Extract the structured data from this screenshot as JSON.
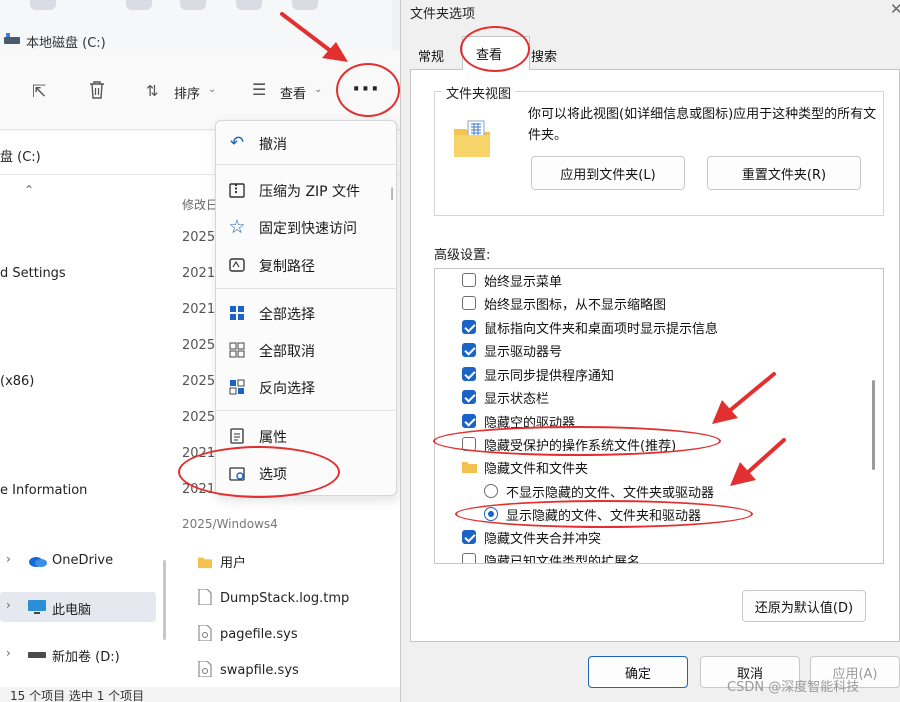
{
  "explorer": {
    "window_title": "本地磁盘 (C:)",
    "toolbar": {
      "sort_label": "排序",
      "view_label": "查看",
      "more_label": "···"
    },
    "address": "盘 (C:)",
    "nav_items": [
      {
        "label": "d Settings"
      },
      {
        "label": "(x86)"
      },
      {
        "label": "e Information"
      },
      {
        "label": "OneDrive"
      },
      {
        "label": "此电脑"
      },
      {
        "label": "新加卷 (D:)"
      }
    ],
    "date_header": "修改日",
    "dates": [
      "2025",
      "2021",
      "2021",
      "2025",
      "2025",
      "2025",
      "2021",
      "2025",
      "2021/"
    ],
    "partial_row": "2025/Windows4",
    "files": [
      {
        "name": "用户"
      },
      {
        "name": "DumpStack.log.tmp"
      },
      {
        "name": "pagefile.sys"
      },
      {
        "name": "swapfile.sys"
      }
    ],
    "status": "15 个项目    选中 1 个项目"
  },
  "context_menu": {
    "items": [
      {
        "label": "撤消",
        "icon": "undo-icon"
      },
      {
        "label": "压缩为 ZIP 文件",
        "icon": "zip-icon"
      },
      {
        "label": "固定到快速访问",
        "icon": "star-icon"
      },
      {
        "label": "复制路径",
        "icon": "copy-path-icon"
      },
      {
        "label": "全部选择",
        "icon": "select-all-icon"
      },
      {
        "label": "全部取消",
        "icon": "select-none-icon"
      },
      {
        "label": "反向选择",
        "icon": "invert-selection-icon"
      },
      {
        "label": "属性",
        "icon": "properties-icon"
      },
      {
        "label": "选项",
        "icon": "options-icon"
      }
    ]
  },
  "dialog": {
    "title": "文件夹选项",
    "tabs": [
      "常规",
      "查看",
      "搜索"
    ],
    "folder_views": {
      "group_title": "文件夹视图",
      "description": "你可以将此视图(如详细信息或图标)应用于这种类型的所有文件夹。",
      "apply_button": "应用到文件夹(L)",
      "reset_button": "重置文件夹(R)"
    },
    "advanced_label": "高级设置:",
    "options": [
      {
        "label": "始终显示菜单",
        "checked": false
      },
      {
        "label": "始终显示图标，从不显示缩略图",
        "checked": false
      },
      {
        "label": "鼠标指向文件夹和桌面项时显示提示信息",
        "checked": true
      },
      {
        "label": "显示驱动器号",
        "checked": true
      },
      {
        "label": "显示同步提供程序通知",
        "checked": true
      },
      {
        "label": "显示状态栏",
        "checked": true
      },
      {
        "label": "隐藏空的驱动器",
        "checked": true
      },
      {
        "label": "隐藏受保护的操作系统文件(推荐)",
        "checked": false
      }
    ],
    "hidden_folder_label": "隐藏文件和文件夹",
    "radio_options": [
      {
        "label": "不显示隐藏的文件、文件夹或驱动器",
        "selected": false
      },
      {
        "label": "显示隐藏的文件、文件夹和驱动器",
        "selected": true
      }
    ],
    "more_options": [
      {
        "label": "隐藏文件夹合并冲突",
        "checked": true
      },
      {
        "label": "隐藏已知文件类型的扩展名",
        "checked": false
      }
    ],
    "restore_button": "还原为默认值(D)",
    "ok_button": "确定",
    "cancel_button": "取消",
    "apply_button": "应用(A)"
  },
  "watermark": "CSDN @深度智能科技",
  "colors": {
    "accent": "#1b63c6",
    "annotation": "#e23030"
  }
}
